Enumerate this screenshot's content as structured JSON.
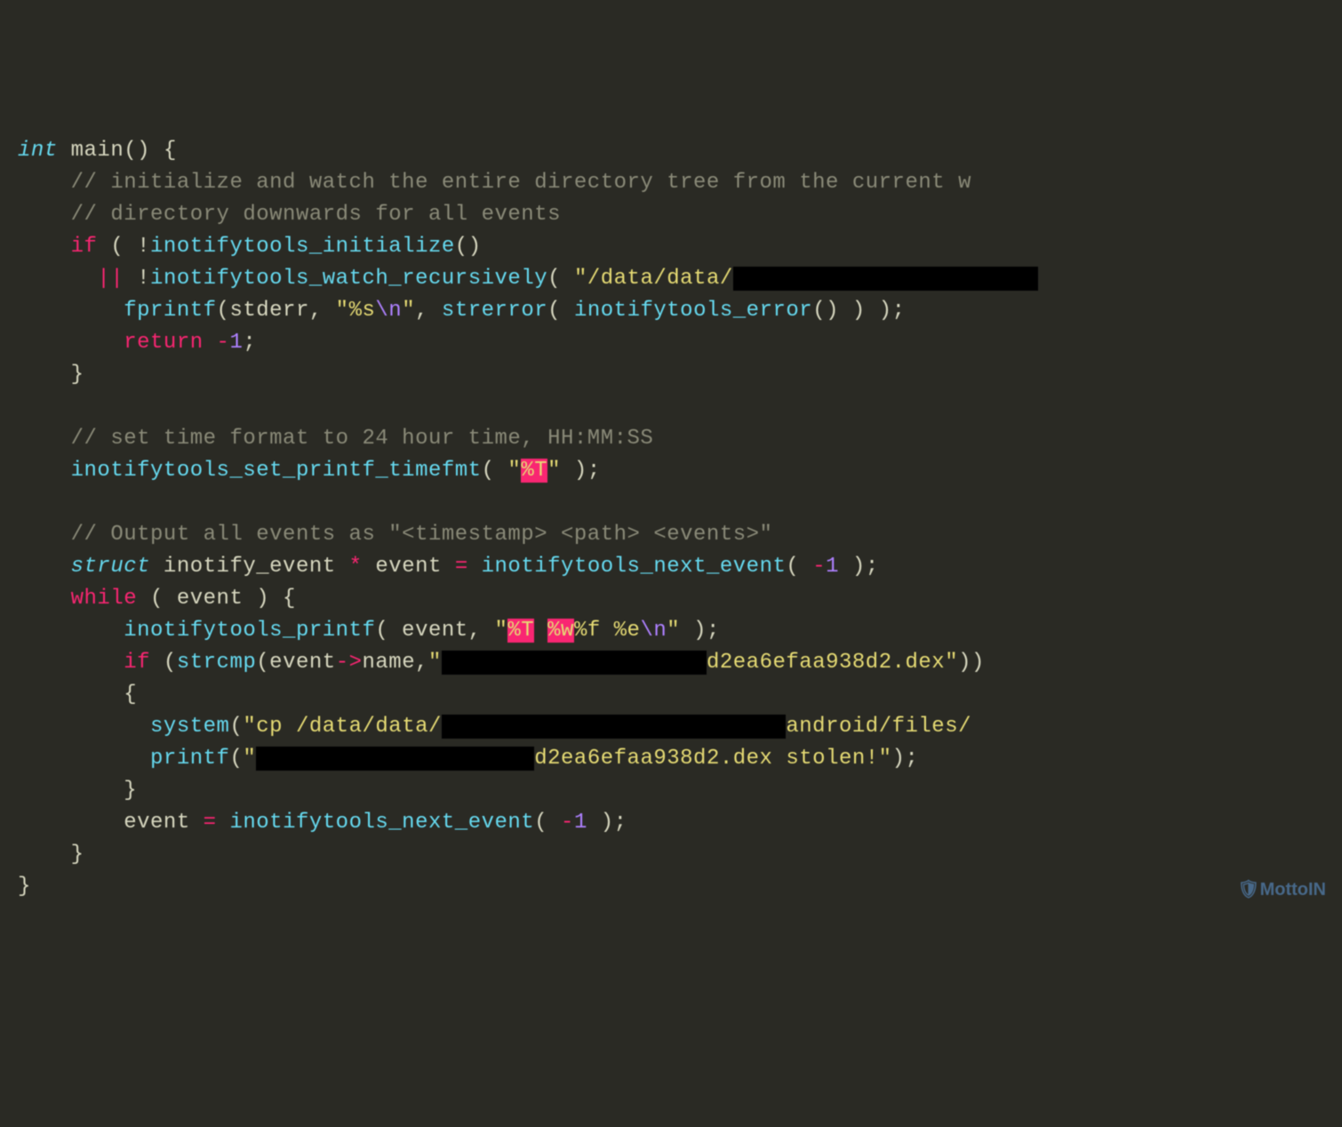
{
  "watermark": "🛡MottoIN",
  "code": {
    "l1_int": "int",
    "l1_rest": " main() {",
    "l2_cmt": "    // initialize and watch the entire directory tree from the current w",
    "l3_cmt": "    // directory downwards for all events",
    "l4_if": "    if",
    "l4_b": " ( !",
    "l4_fn": "inotifytools_initialize",
    "l4_c": "()",
    "l5_a": "      ",
    "l5_op": "||",
    "l5_b": " !",
    "l5_fn": "inotifytools_watch_recursively",
    "l5_c": "( ",
    "l5_str": "\"/data/data/",
    "l5_red": "                       ",
    "l6_a": "        ",
    "l6_fn": "fprintf",
    "l6_b": "(stderr, ",
    "l6_s1": "\"",
    "l6_fmt": "%s",
    "l6_esc": "\\n",
    "l6_s2": "\"",
    "l6_c": ", ",
    "l6_fn2": "strerror",
    "l6_d": "( ",
    "l6_fn3": "inotifytools_error",
    "l6_e": "() ) );",
    "l7_a": "        ",
    "l7_ret": "return",
    "l7_b": " ",
    "l7_neg": "-",
    "l7_num": "1",
    "l7_c": ";",
    "l8": "    }",
    "l9": " ",
    "l10_cmt": "    // set time format to 24 hour time, HH:MM:SS",
    "l11_a": "    ",
    "l11_fn": "inotifytools_set_printf_timefmt",
    "l11_b": "( ",
    "l11_s1": "\"",
    "l11_fmt": "%T",
    "l11_s2": "\"",
    "l11_c": " );",
    "l12": " ",
    "l13_cmt": "    // Output all events as \"<timestamp> <path> <events>\"",
    "l14_a": "    ",
    "l14_struct": "struct",
    "l14_b": " inotify_event ",
    "l14_op": "*",
    "l14_c": " event ",
    "l14_eq": "=",
    "l14_d": " ",
    "l14_fn": "inotifytools_next_event",
    "l14_e": "( ",
    "l14_neg": "-",
    "l14_num": "1",
    "l14_f": " );",
    "l15_a": "    ",
    "l15_while": "while",
    "l15_b": " ( event ) {",
    "l16_a": "        ",
    "l16_fn": "inotifytools_printf",
    "l16_b": "( event, ",
    "l16_s1": "\"",
    "l16_f1": "%T",
    "l16_sp1": " ",
    "l16_f2": "%w",
    "l16_s2": "%f %e",
    "l16_esc": "\\n",
    "l16_s3": "\"",
    "l16_c": " );",
    "l17_a": "        ",
    "l17_if": "if",
    "l17_b": " (",
    "l17_fn": "strcmp",
    "l17_c": "(event",
    "l17_arrow": "->",
    "l17_d": "name,",
    "l17_s1": "\"",
    "l17_red": "                    ",
    "l17_s2": "d2ea6efaa938d2.dex\"",
    "l17_e": "))",
    "l18": "        {",
    "l19_a": "          ",
    "l19_fn": "system",
    "l19_b": "(",
    "l19_s1": "\"cp /data/data/",
    "l19_red": "                          ",
    "l19_s2": "android/files/",
    "l20_a": "          ",
    "l20_fn": "printf",
    "l20_b": "(",
    "l20_s1": "\"",
    "l20_red": "                     ",
    "l20_s2": "d2ea6efaa938d2.dex stolen!\"",
    "l20_c": ");",
    "l21": "        }",
    "l22_a": "        event ",
    "l22_eq": "=",
    "l22_b": " ",
    "l22_fn": "inotifytools_next_event",
    "l22_c": "( ",
    "l22_neg": "-",
    "l22_num": "1",
    "l22_d": " );",
    "l23": "    }",
    "l24": "}"
  }
}
